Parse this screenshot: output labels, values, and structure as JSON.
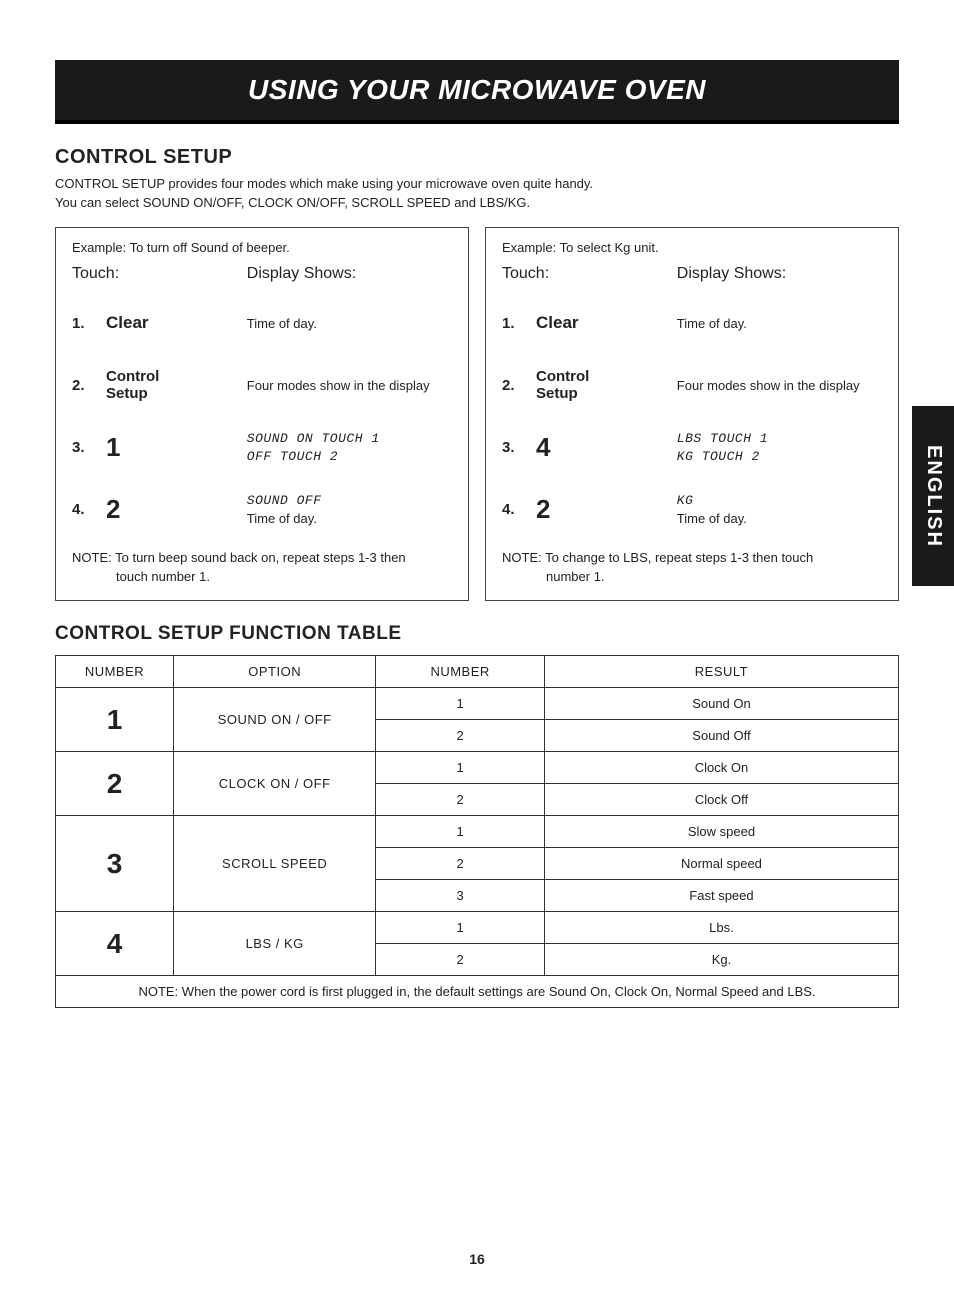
{
  "banner": "USING YOUR MICROWAVE OVEN",
  "side_tab": "ENGLISH",
  "page_number": "16",
  "control_setup": {
    "heading": "CONTROL SETUP",
    "intro_line1": "CONTROL SETUP provides four modes which make using your microwave oven quite handy.",
    "intro_line2": "You can select SOUND ON/OFF, CLOCK ON/OFF, SCROLL SPEED and LBS/KG."
  },
  "example_left": {
    "title": "Example: To turn off Sound of beeper.",
    "touch_label": "Touch:",
    "display_label": "Display Shows:",
    "steps": [
      {
        "num": "1.",
        "touch": "Clear",
        "display": "Time of day."
      },
      {
        "num": "2.",
        "touch": "Control\nSetup",
        "display": "Four modes show in the display"
      },
      {
        "num": "3.",
        "touch": "1",
        "display_lcd1": "SOUND ON TOUCH 1",
        "display_lcd2": "OFF TOUCH 2"
      },
      {
        "num": "4.",
        "touch": "2",
        "display_lcd1": "SOUND OFF",
        "display_tod": "Time of day."
      }
    ],
    "note_label": "NOTE:",
    "note_text1": "To turn beep sound back on, repeat steps 1-3 then",
    "note_text2": "touch number 1."
  },
  "example_right": {
    "title": "Example: To select Kg unit.",
    "touch_label": "Touch:",
    "display_label": "Display Shows:",
    "steps": [
      {
        "num": "1.",
        "touch": "Clear",
        "display": "Time of day."
      },
      {
        "num": "2.",
        "touch": "Control\nSetup",
        "display": "Four modes show in the display"
      },
      {
        "num": "3.",
        "touch": "4",
        "display_lcd1": "LBS TOUCH 1",
        "display_lcd2": "KG TOUCH 2"
      },
      {
        "num": "4.",
        "touch": "2",
        "display_lcd1": "KG",
        "display_tod": "Time of day."
      }
    ],
    "note_label": "NOTE:",
    "note_text1": "To change to LBS, repeat steps 1-3 then touch",
    "note_text2": "number 1."
  },
  "function_table": {
    "heading": "CONTROL SETUP FUNCTION TABLE",
    "headers": [
      "NUMBER",
      "OPTION",
      "NUMBER",
      "RESULT"
    ],
    "groups": [
      {
        "big": "1",
        "option": "SOUND ON / OFF",
        "rows": [
          {
            "n": "1",
            "result": "Sound On"
          },
          {
            "n": "2",
            "result": "Sound Off"
          }
        ]
      },
      {
        "big": "2",
        "option": "CLOCK ON / OFF",
        "rows": [
          {
            "n": "1",
            "result": "Clock On"
          },
          {
            "n": "2",
            "result": "Clock Off"
          }
        ]
      },
      {
        "big": "3",
        "option": "SCROLL SPEED",
        "rows": [
          {
            "n": "1",
            "result": "Slow speed"
          },
          {
            "n": "2",
            "result": "Normal speed"
          },
          {
            "n": "3",
            "result": "Fast speed"
          }
        ]
      },
      {
        "big": "4",
        "option": "LBS / KG",
        "rows": [
          {
            "n": "1",
            "result": "Lbs."
          },
          {
            "n": "2",
            "result": "Kg."
          }
        ]
      }
    ],
    "note_label": "NOTE:",
    "note_text": "When the power cord is first plugged in, the default settings are Sound On, Clock On, Normal Speed and LBS."
  }
}
